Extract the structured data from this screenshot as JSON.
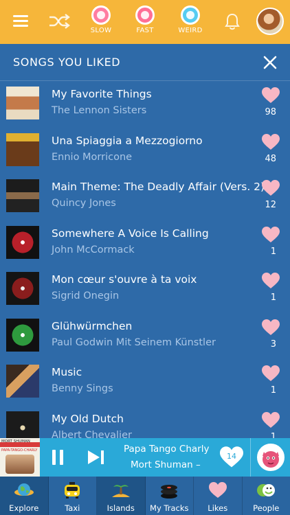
{
  "header": {
    "modes": [
      {
        "label": "SLOW",
        "color": "#ff5c8a"
      },
      {
        "label": "FAST",
        "color": "#ff5c8a"
      },
      {
        "label": "WEIRD",
        "color": "#49c8f0"
      }
    ]
  },
  "list": {
    "title": "SONGS YOU LIKED",
    "songs": [
      {
        "title": "My Favorite Things",
        "artist": "The Lennon Sisters",
        "likes": "98"
      },
      {
        "title": "Una Spiaggia a Mezzogiorno",
        "artist": "Ennio Morricone",
        "likes": "48"
      },
      {
        "title": "Main Theme: The Deadly Affair (Vers. 2)",
        "artist": "Quincy Jones",
        "likes": "12"
      },
      {
        "title": "Somewhere A Voice Is Calling",
        "artist": "John McCormack",
        "likes": "1"
      },
      {
        "title": "Mon cœur s'ouvre à ta voix",
        "artist": "Sigrid Onegin",
        "likes": "1"
      },
      {
        "title": "Glühwürmchen",
        "artist": "Paul Godwin Mit Seinem Künstler",
        "likes": "3"
      },
      {
        "title": "Music",
        "artist": "Benny Sings",
        "likes": "1"
      },
      {
        "title": "My Old Dutch",
        "artist": "Albert Chevalier",
        "likes": "1"
      }
    ]
  },
  "player": {
    "title": "Papa Tango Charly",
    "artist": "Mort Shuman –",
    "likes": "14",
    "cover_text_1": "MORT SHUMAN",
    "cover_text_2": "PAPA-TANGO-CHARLY"
  },
  "tabs": [
    {
      "label": "Explore",
      "icon": "globe-icon"
    },
    {
      "label": "Taxi",
      "icon": "taxi-icon"
    },
    {
      "label": "Islands",
      "icon": "island-icon"
    },
    {
      "label": "My Tracks",
      "icon": "records-icon"
    },
    {
      "label": "Likes",
      "icon": "heart-icon"
    },
    {
      "label": "People",
      "icon": "people-icon"
    }
  ],
  "colors": {
    "topbar": "#f6b63a",
    "background": "#2e6aa8",
    "heart": "#f7b7c4",
    "player": "#2aa9d8",
    "artist_text": "#a9c6e6"
  }
}
